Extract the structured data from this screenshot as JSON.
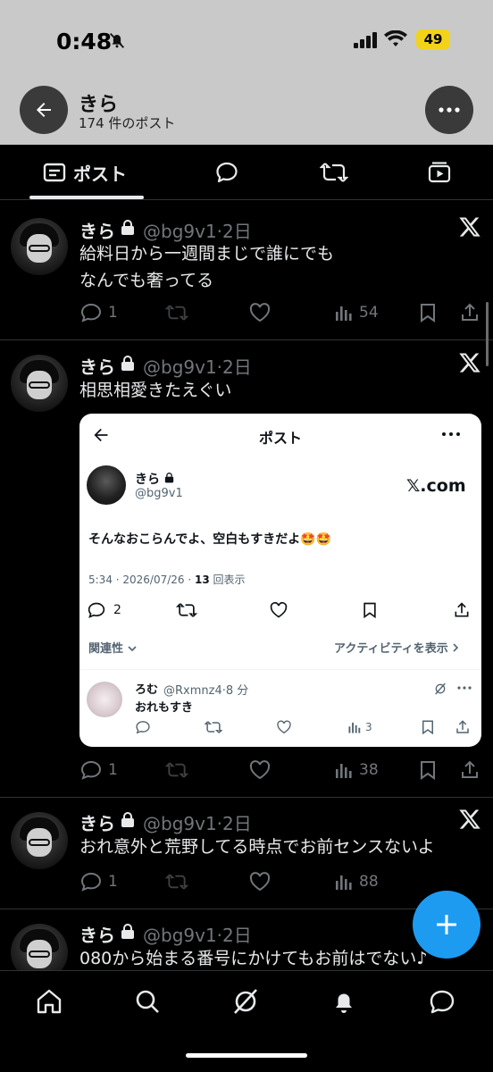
{
  "status_bar": {
    "time": "0:48",
    "battery": "49"
  },
  "header": {
    "name": "きら",
    "post_count": "174 件のポスト"
  },
  "tabs": [
    {
      "label": "ポスト",
      "icon": "posts-icon",
      "active": true
    },
    {
      "label": "",
      "icon": "replies-icon"
    },
    {
      "label": "",
      "icon": "reposts-icon"
    },
    {
      "label": "",
      "icon": "media-icon"
    }
  ],
  "posts": [
    {
      "name": "きら",
      "handle": "@bg9v1·2日",
      "text_lines": [
        "給料日から一週間まじで誰にでも",
        "なんでも奢ってる"
      ],
      "replies": "1",
      "retweets": "",
      "likes": "",
      "views": "54"
    },
    {
      "name": "きら",
      "handle": "@bg9v1·2日",
      "text_lines": [
        "相思相愛きたえぐい"
      ],
      "replies": "1",
      "retweets": "",
      "likes": "",
      "views": "38"
    },
    {
      "name": "きら",
      "handle": "@bg9v1·2日",
      "text_lines": [
        "おれ意外と荒野してる時点でお前センスないよ"
      ],
      "replies": "1",
      "retweets": "",
      "likes": "",
      "views": "88"
    },
    {
      "name": "きら",
      "handle": "@bg9v1·2日",
      "text_lines": [
        "080から始まる番号にかけてもお前はでない♪"
      ]
    }
  ],
  "embedded": {
    "title": "ポスト",
    "name": "きら",
    "handle": "@bg9v1",
    "brand": "𝕏.com",
    "text": "そんなおこらんでよ、空白もすきだよ🤩🤩",
    "meta_prefix": "5:34 · 2026/07/26 · ",
    "meta_count": "13",
    "meta_suffix": " 回表示",
    "replies": "2",
    "related": "関連性",
    "activity": "アクティビティを表示",
    "reply": {
      "name": "ろむ",
      "handle": "@Rxmnz4·8 分",
      "text": "おれもすき",
      "views": "3"
    }
  },
  "colors": {
    "accent": "#1d9bf0",
    "header_bg": "#c9c9c9",
    "muted": "#71767b",
    "battery": "#f2d31a"
  }
}
